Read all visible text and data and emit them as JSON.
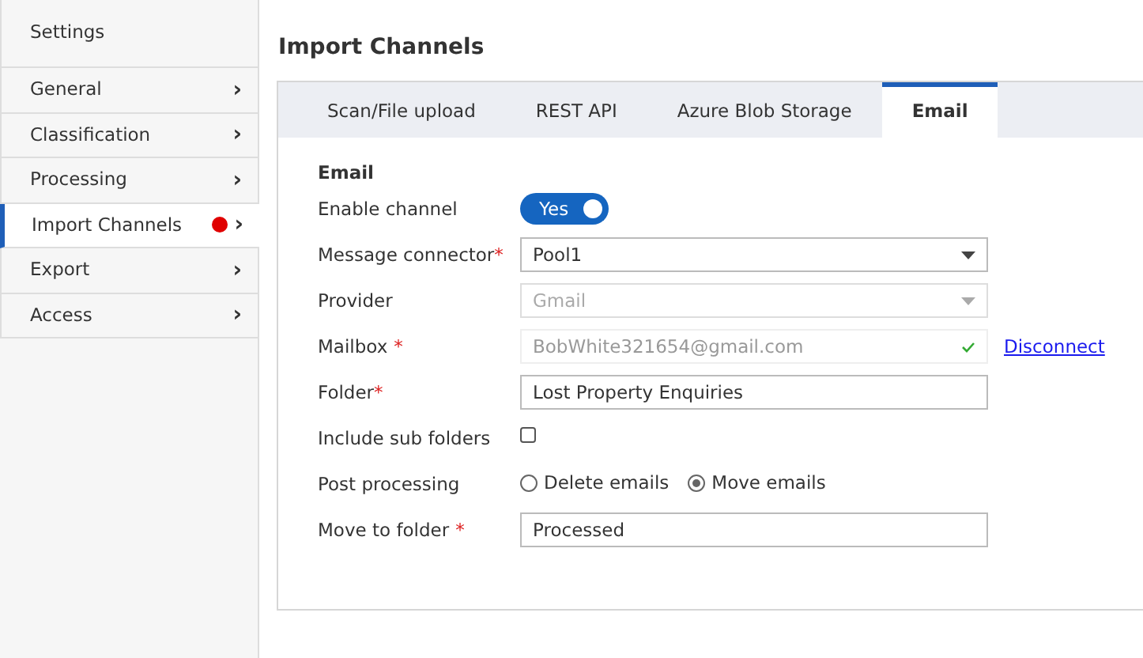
{
  "sidebar": {
    "title": "Settings",
    "items": [
      {
        "label": "General",
        "selected": false,
        "alert": false,
        "chevron": "›"
      },
      {
        "label": "Classification",
        "selected": false,
        "alert": false,
        "chevron": "›"
      },
      {
        "label": "Processing",
        "selected": false,
        "alert": false,
        "chevron": "›"
      },
      {
        "label": "Import Channels",
        "selected": true,
        "alert": true,
        "chevron": "›"
      },
      {
        "label": "Export",
        "selected": false,
        "alert": false,
        "chevron": "›"
      },
      {
        "label": "Access",
        "selected": false,
        "alert": false,
        "chevron": "›"
      }
    ]
  },
  "page_title": "Import Channels",
  "tabs": [
    {
      "label": "Scan/File upload",
      "selected": false
    },
    {
      "label": "REST API",
      "selected": false
    },
    {
      "label": "Azure Blob Storage",
      "selected": false
    },
    {
      "label": "Email",
      "selected": true
    }
  ],
  "section_title": "Email",
  "fields": [
    {
      "kind": "toggle",
      "label": "Enable channel",
      "on": true,
      "text": "Yes"
    },
    {
      "kind": "select",
      "label": "Message connector",
      "required_mark": "*",
      "value": "Pool1",
      "disabled": false
    },
    {
      "kind": "select",
      "label": "Provider",
      "value": "Gmail",
      "disabled": true
    },
    {
      "kind": "verified",
      "label": "Mailbox",
      "required_mark": "*",
      "mark_gap": true,
      "value": "BobWhite321654@gmail.com",
      "link": "Disconnect"
    },
    {
      "kind": "text",
      "label": "Folder",
      "required_mark": "*",
      "value": "Lost Property Enquiries"
    },
    {
      "kind": "checkbox",
      "label": "Include sub folders",
      "checked": false
    },
    {
      "kind": "radio",
      "label": "Post processing",
      "options": [
        {
          "label": "Delete emails",
          "selected": false
        },
        {
          "label": "Move emails",
          "selected": true
        }
      ]
    },
    {
      "kind": "text",
      "label": "Move to folder",
      "required_mark": "*",
      "mark_gap": true,
      "value": "Processed"
    }
  ]
}
